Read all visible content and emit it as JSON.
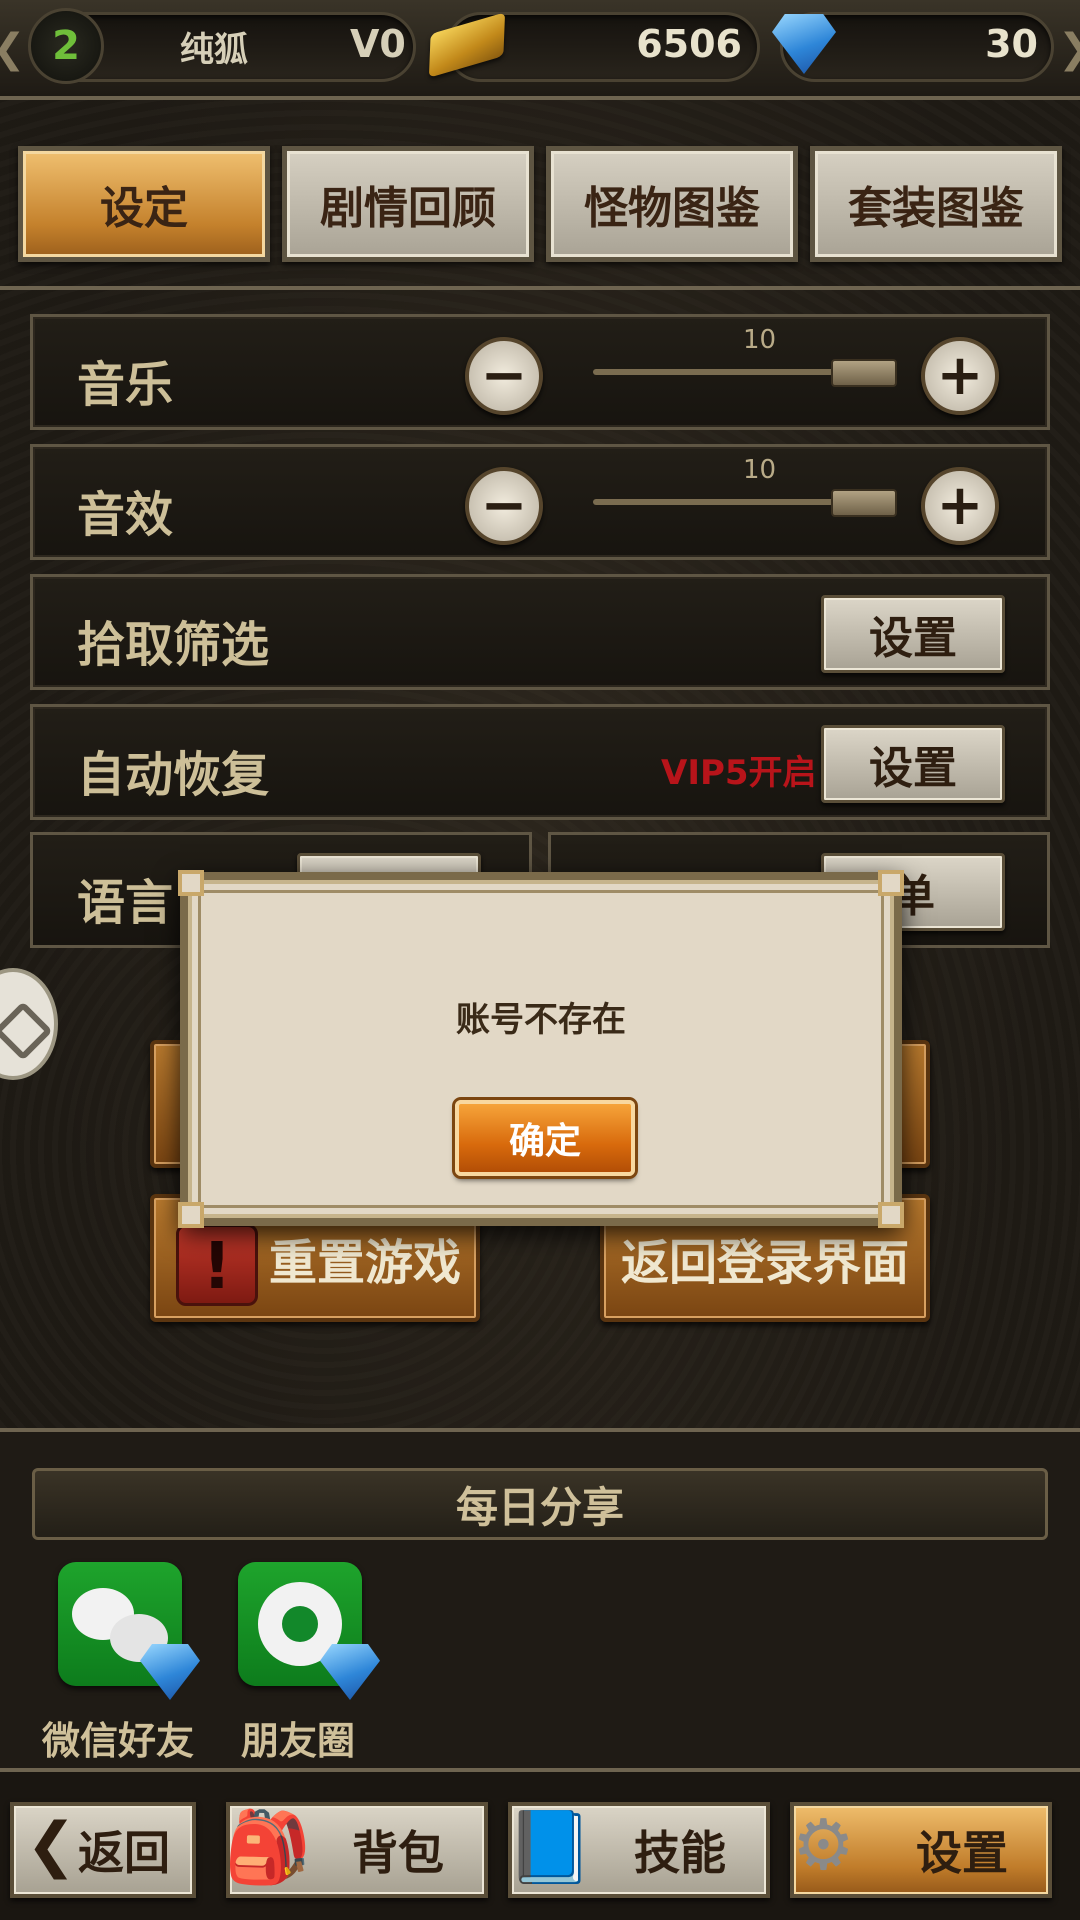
{
  "header": {
    "level": "2",
    "player_name": "纯狐",
    "vip_level": "V0",
    "gold": "6506",
    "gems": "30"
  },
  "tabs": [
    {
      "label": "设定",
      "active": true
    },
    {
      "label": "剧情回顾",
      "active": false
    },
    {
      "label": "怪物图鉴",
      "active": false
    },
    {
      "label": "套装图鉴",
      "active": false
    }
  ],
  "settings": {
    "music": {
      "label": "音乐",
      "value": "10"
    },
    "sound": {
      "label": "音效",
      "value": "10"
    },
    "pickup_filter": {
      "label": "拾取筛选",
      "button": "设置"
    },
    "auto_recover": {
      "label": "自动恢复",
      "vip_note": "VIP5开启",
      "button": "设置"
    },
    "language": {
      "label": "语言"
    },
    "partial_button": "单"
  },
  "actions": {
    "reset_game": "重置游戏",
    "return_login": "返回登录界面"
  },
  "share": {
    "title": "每日分享",
    "items": [
      {
        "label": "微信好友",
        "icon": "wechat-icon"
      },
      {
        "label": "朋友圈",
        "icon": "moments-icon"
      }
    ]
  },
  "bottom_nav": {
    "back": "返回",
    "bag": "背包",
    "skills": "技能",
    "settings": "设置"
  },
  "modal": {
    "message": "账号不存在",
    "confirm": "确定"
  },
  "colors": {
    "accent_orange": "#d86a0c",
    "vip_red": "#b8141a",
    "level_green": "#6fbf3a"
  }
}
